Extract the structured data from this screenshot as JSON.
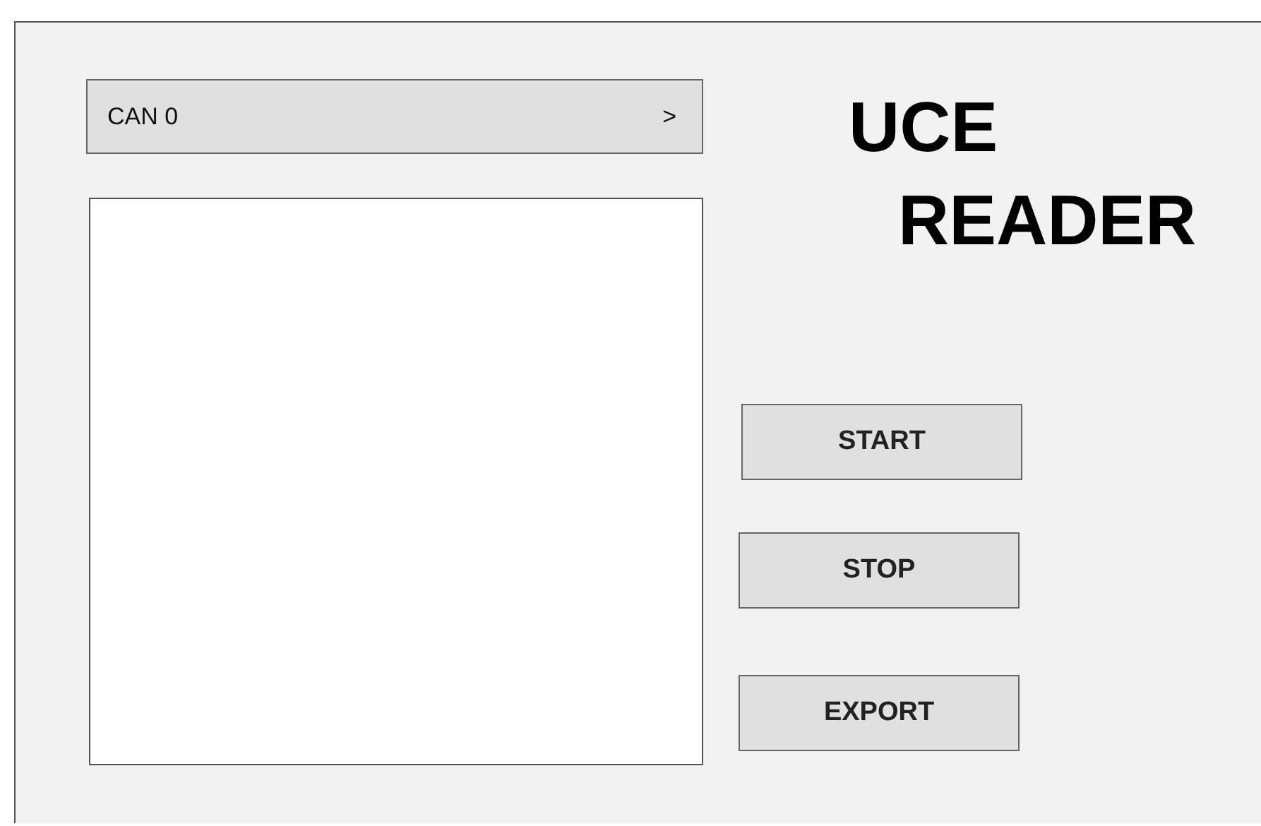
{
  "selector": {
    "value": "CAN 0",
    "caret": ">"
  },
  "title": [
    "UCE",
    "READER"
  ],
  "buttons": [
    "START",
    "STOP",
    "EXPORT"
  ]
}
